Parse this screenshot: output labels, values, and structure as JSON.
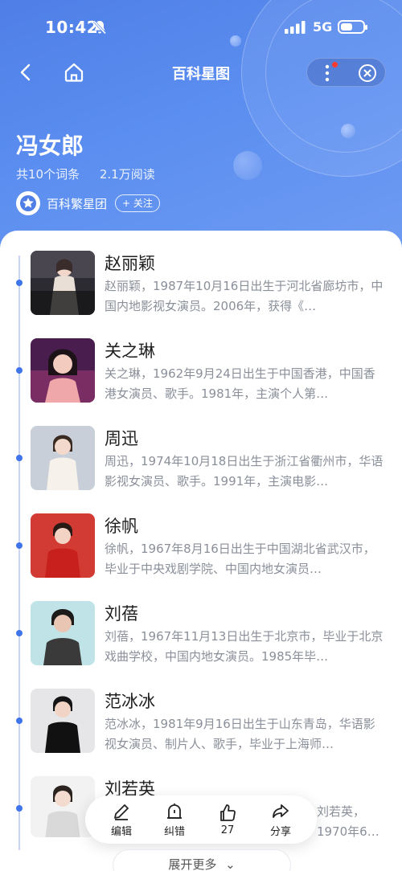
{
  "status": {
    "time": "10:42",
    "network": "5G"
  },
  "nav": {
    "title": "百科星图"
  },
  "header": {
    "title": "冯女郎",
    "entries": "共10个词条",
    "reads": "2.1万阅读",
    "owner": "百科繁星团",
    "follow_label": "+ 关注"
  },
  "items": [
    {
      "name": "赵丽颖",
      "desc": "赵丽颖，1987年10月16日出生于河北省廊坊市，中国内地影视女演员。2006年，获得《…"
    },
    {
      "name": "关之琳",
      "desc": "关之琳，1962年9月24日出生于中国香港，中国香港女演员、歌手。1981年，主演个人第…"
    },
    {
      "name": "周迅",
      "desc": "周迅，1974年10月18日出生于浙江省衢州市，华语影视女演员、歌手。1991年，主演电影…"
    },
    {
      "name": "徐帆",
      "desc": "徐帆，1967年8月16日出生于中国湖北省武汉市，毕业于中央戏剧学院、中国内地女演员…"
    },
    {
      "name": "刘蓓",
      "desc": "刘蓓，1967年11月13日出生于北京市，毕业于北京戏曲学校，中国内地女演员。1985年毕…"
    },
    {
      "name": "范冰冰",
      "desc": "范冰冰，1981年9月16日出生于山东青岛，华语影视女演员、制片人、歌手，毕业于上海师…"
    },
    {
      "name": "刘若英",
      "desc": "刘若英，1970年6月1日出生于中国台湾，毕业于美…"
    }
  ],
  "actions": {
    "edit": "编辑",
    "correct": "纠错",
    "likes": "27",
    "share": "分享"
  },
  "expand_label": "展开更多"
}
